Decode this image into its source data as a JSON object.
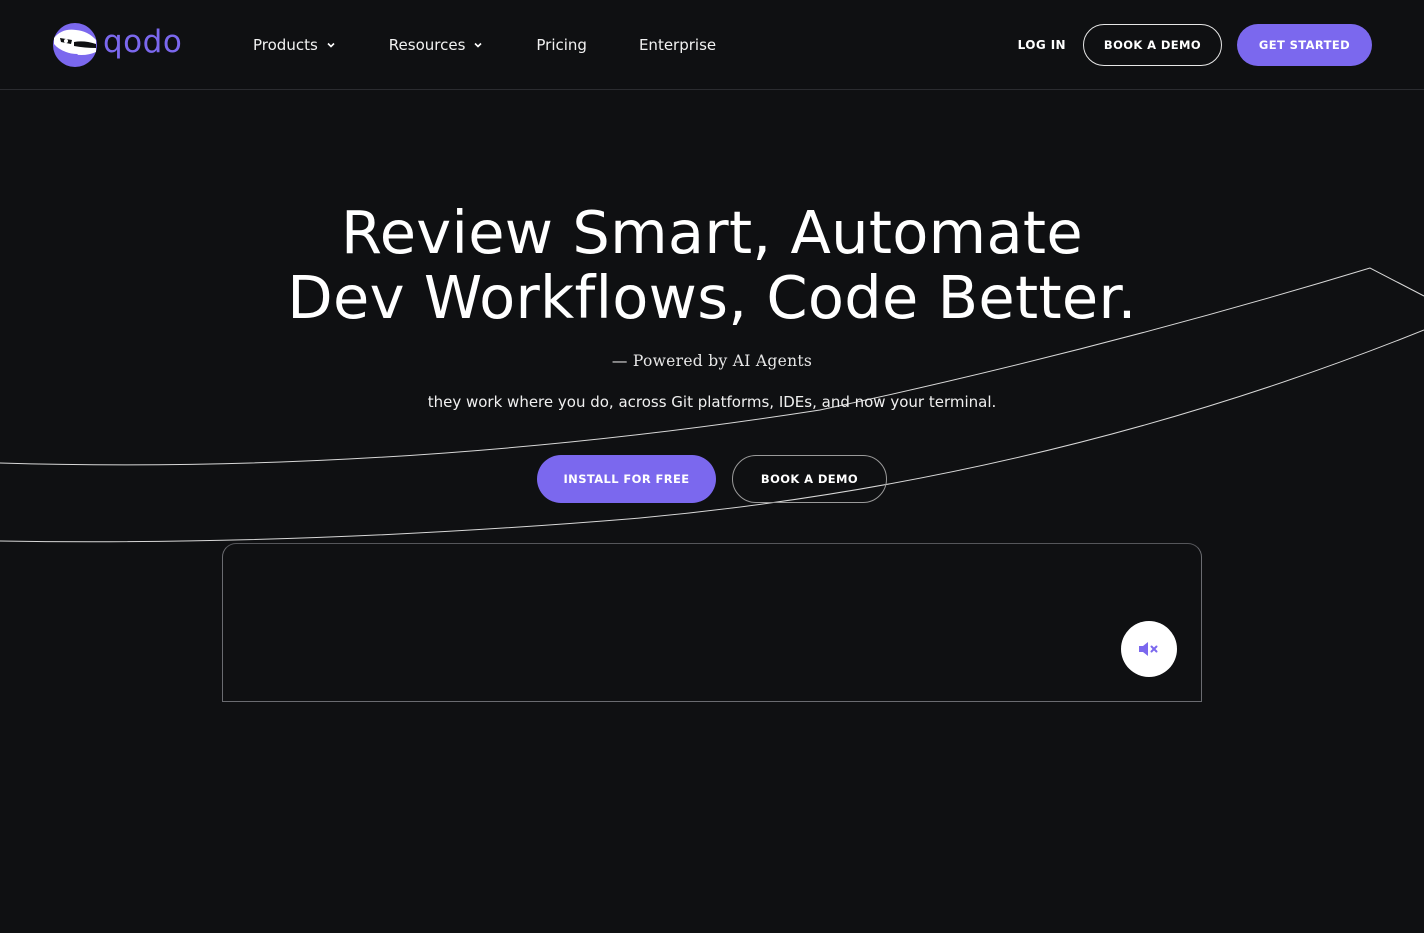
{
  "brand": {
    "name": "qodo",
    "accent": "#7b68ee",
    "background": "#0f1012"
  },
  "nav": {
    "items": [
      {
        "label": "Products",
        "has_dropdown": true
      },
      {
        "label": "Resources",
        "has_dropdown": true
      },
      {
        "label": "Pricing",
        "has_dropdown": false
      },
      {
        "label": "Enterprise",
        "has_dropdown": false
      }
    ]
  },
  "header_actions": {
    "login": "LOG IN",
    "book_demo": "BOOK A DEMO",
    "get_started": "GET STARTED"
  },
  "hero": {
    "title_line1": "Review Smart, Automate",
    "title_line2": "Dev Workflows, Code Better.",
    "tagline": "— Powered by AI Agents",
    "subtitle": "they work where you do, across Git platforms, IDEs, and now your terminal.",
    "install_button": "INSTALL FOR FREE",
    "demo_button": "BOOK A DEMO"
  },
  "video": {
    "mute_icon": "speaker-muted-icon"
  }
}
